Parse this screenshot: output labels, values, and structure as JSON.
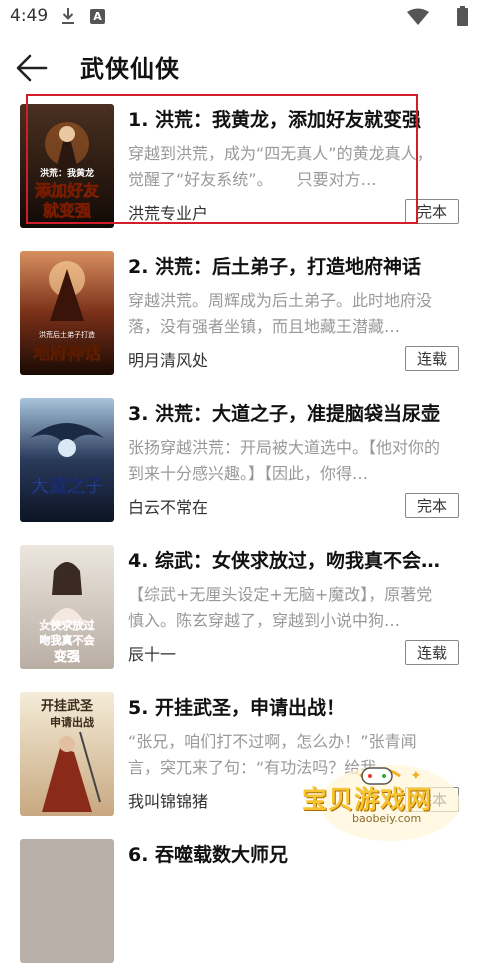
{
  "status_bar": {
    "time": "4:49",
    "notification_letter": "A"
  },
  "header": {
    "title": "武侠仙侠"
  },
  "books": [
    {
      "index_title": "1. 洪荒：我黄龙，添加好友就变强",
      "description": "穿越到洪荒，成为“四无真人”的黄龙真人，觉醒了“好友系统”。　　只要对方…",
      "author": "洪荒专业户",
      "status": "完本",
      "cover": {
        "top_text": "洪荒：我黄龙",
        "main_text": "添加好友就变强",
        "bg": "#2a1a12",
        "accent": "#f5d76e"
      }
    },
    {
      "index_title": "2. 洪荒：后土弟子，打造地府神话",
      "description": "穿越洪荒。周辉成为后土弟子。此时地府没落，没有强者坐镇，而且地藏王潜藏…",
      "author": "明月清风处",
      "status": "连载",
      "cover": {
        "top_text": "洪荒后土弟子打造",
        "main_text": "地府神话",
        "bg": "#3a1c0e",
        "accent": "#f0c040"
      }
    },
    {
      "index_title": "3. 洪荒：大道之子，准提脑袋当尿壶",
      "description": "张扬穿越洪荒：开局被大道选中。【他对你的到来十分感兴趣。】【因此，你得…",
      "author": "白云不常在",
      "status": "完本",
      "cover": {
        "top_text": "",
        "main_text": "大道之子",
        "bg": "#1c2a44",
        "accent": "#8fd0ff"
      }
    },
    {
      "index_title": "4. 综武：女侠求放过，吻我真不会…",
      "description": "【综武+无厘头设定+无脑+魔改】，原著党慎入。陈玄穿越了，穿越到小说中狗…",
      "author": "辰十一",
      "status": "连载",
      "cover": {
        "top_text": "",
        "main_text": "女侠求放过吻我真不会变强",
        "bg": "#d8d2cc",
        "accent": "#e0262c"
      }
    },
    {
      "index_title": "5. 开挂武圣，申请出战！",
      "description": "“张兄，咱们打不过啊，怎么办！”张青闻言，突兀来了句：“有功法吗？给我…",
      "author": "我叫锦锦猪",
      "status": "完本",
      "cover": {
        "top_text": "",
        "main_text": "开挂武圣申请出战",
        "bg": "#e8dcc4",
        "accent": "#3a2a1a"
      }
    },
    {
      "index_title": "6. 吞噬载数大师兄",
      "description": "",
      "author": "",
      "status": "",
      "cover": {
        "top_text": "",
        "main_text": "",
        "bg": "#b8b0a8",
        "accent": "#333333"
      }
    }
  ],
  "watermark": {
    "title": "宝贝游戏网",
    "url": "baobeiy.com"
  }
}
